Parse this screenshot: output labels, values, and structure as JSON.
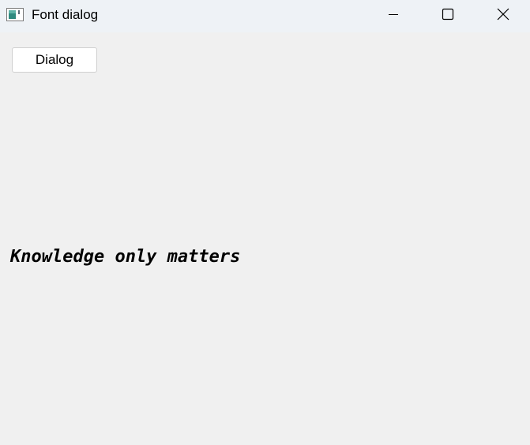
{
  "window": {
    "title": "Font dialog",
    "icon": "app-window-icon",
    "controls": {
      "minimize": "minimize-icon",
      "maximize": "maximize-icon",
      "close": "close-icon"
    }
  },
  "toolbar": {
    "dialog_label": "Dialog"
  },
  "content": {
    "sample_text": "Knowledge only matters"
  }
}
